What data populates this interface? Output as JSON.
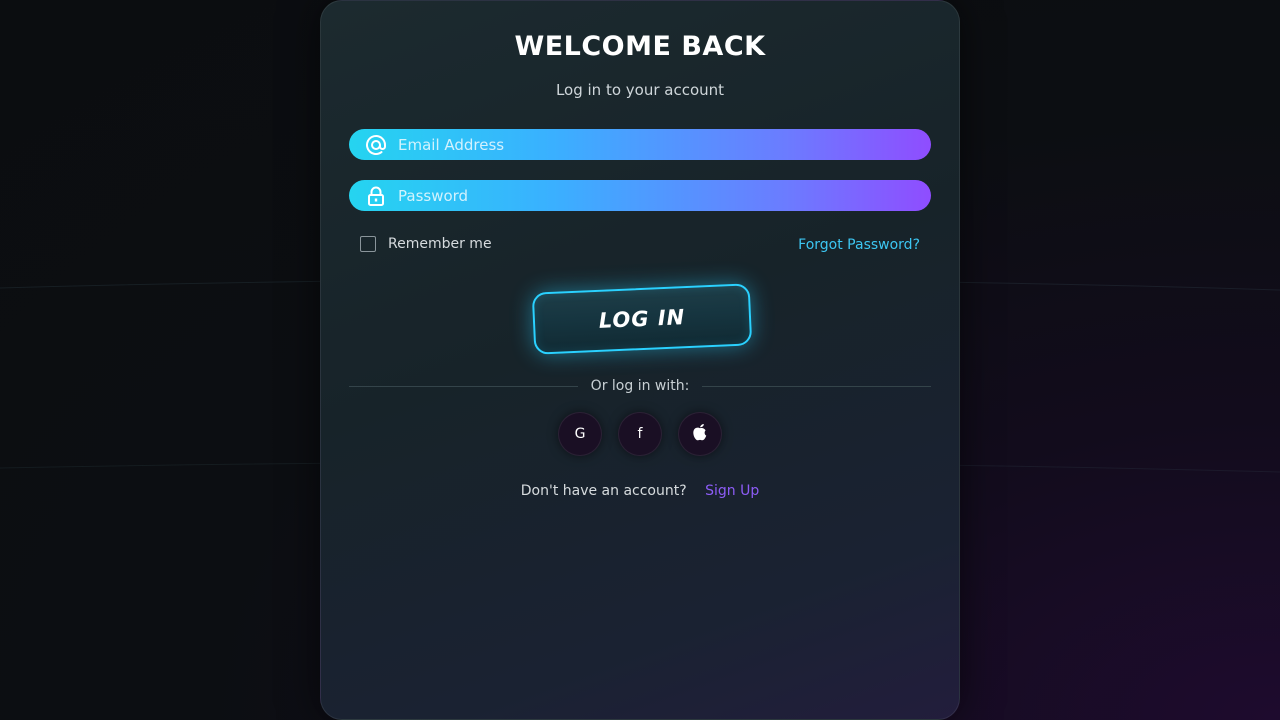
{
  "header": {
    "title": "WELCOME BACK",
    "subtitle": "Log in to your account"
  },
  "form": {
    "email": {
      "placeholder": "Email Address",
      "value": "",
      "icon": "at-sign-icon"
    },
    "password": {
      "placeholder": "Password",
      "value": "",
      "icon": "lock-icon"
    },
    "remember_label": "Remember me",
    "remember_checked": false,
    "forgot_label": "Forgot Password?",
    "login_label": "LOG IN"
  },
  "social": {
    "divider_text": "Or log in with:",
    "buttons": [
      {
        "label": "G",
        "icon": "google-icon"
      },
      {
        "label": "f",
        "icon": "facebook-icon"
      },
      {
        "label": "",
        "icon": "apple-icon"
      }
    ]
  },
  "footer": {
    "question": "Don't have an account?",
    "signup_label": "Sign Up"
  },
  "colors": {
    "accent_cyan": "#2ad1ff",
    "accent_purple": "#8d5cf6",
    "field_gradient_start": "#25d4f0",
    "field_gradient_end": "#8f4dff"
  }
}
